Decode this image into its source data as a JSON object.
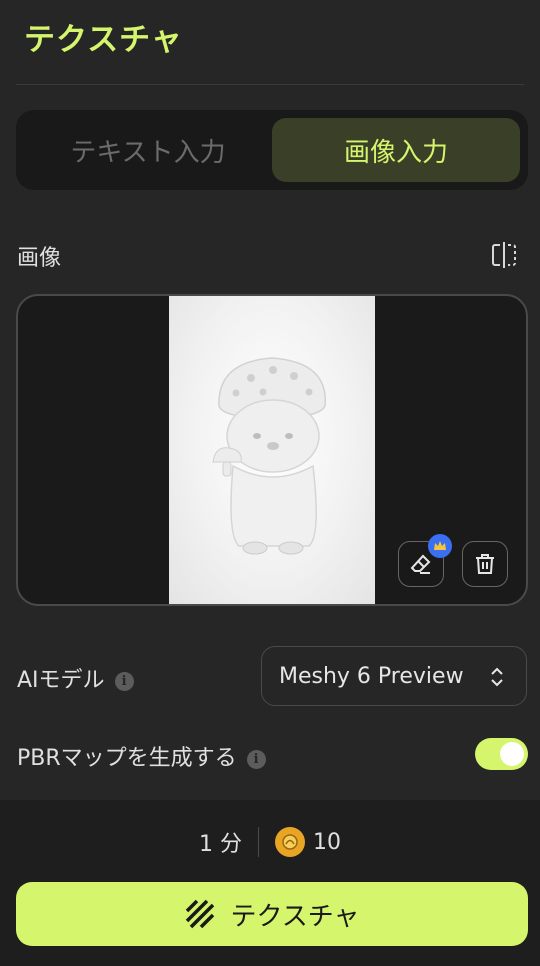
{
  "header": {
    "title": "テクスチャ"
  },
  "input_mode": {
    "tabs": [
      {
        "label": "テキスト入力",
        "active": false
      },
      {
        "label": "画像入力",
        "active": true
      }
    ]
  },
  "image_section": {
    "label": "画像",
    "compare_icon": "compare-split-icon",
    "edit_icon": "eraser-icon",
    "delete_icon": "trash-icon",
    "premium_icon": "crown-icon"
  },
  "model": {
    "label": "AIモデル",
    "selected": "Meshy 6 Preview"
  },
  "pbr": {
    "label": "PBRマップを生成する",
    "enabled": true
  },
  "footer": {
    "time": "1 分",
    "cost": "10",
    "button_label": "テクスチャ"
  },
  "colors": {
    "accent": "#d4f56c",
    "background": "#262626",
    "premium": "#3b6ff2"
  }
}
